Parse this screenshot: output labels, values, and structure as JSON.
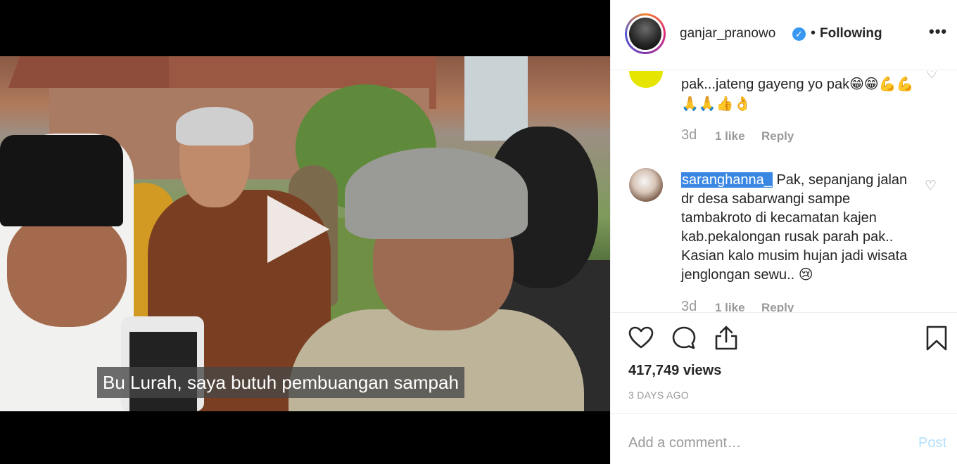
{
  "video": {
    "subtitle": "Bu Lurah, saya butuh pembuangan sampah"
  },
  "header": {
    "username": "ganjar_pranowo",
    "verified_mark": "✓",
    "separator": "•",
    "follow_status": "Following",
    "more_label": "•••"
  },
  "comments": [
    {
      "text": "pak...jateng gayeng yo pak😁😁💪💪🙏🙏👍👌",
      "age": "3d",
      "likes": "1 like",
      "reply": "Reply"
    },
    {
      "username": "saranghanna_",
      "text": "Pak, sepanjang jalan dr desa sabarwangi sampe tambakroto di kecamatan kajen kab.pekalongan rusak parah pak.. Kasian kalo musim hujan jadi wisata jenglongan sewu.. 😢",
      "age": "3d",
      "likes": "1 like",
      "reply": "Reply"
    }
  ],
  "stats": {
    "views": "417,749 views",
    "date": "3 DAYS AGO"
  },
  "comment_box": {
    "placeholder": "Add a comment…",
    "post_label": "Post"
  },
  "icons": [
    "play-icon",
    "verified-badge-icon",
    "more-options-icon",
    "heart-icon",
    "comment-icon",
    "share-icon",
    "bookmark-icon",
    "heart-small-icon"
  ],
  "colors": {
    "verified": "#3897f0",
    "highlight": "#3a86e3",
    "post_disabled": "#b2dffc",
    "muted": "#999999"
  }
}
